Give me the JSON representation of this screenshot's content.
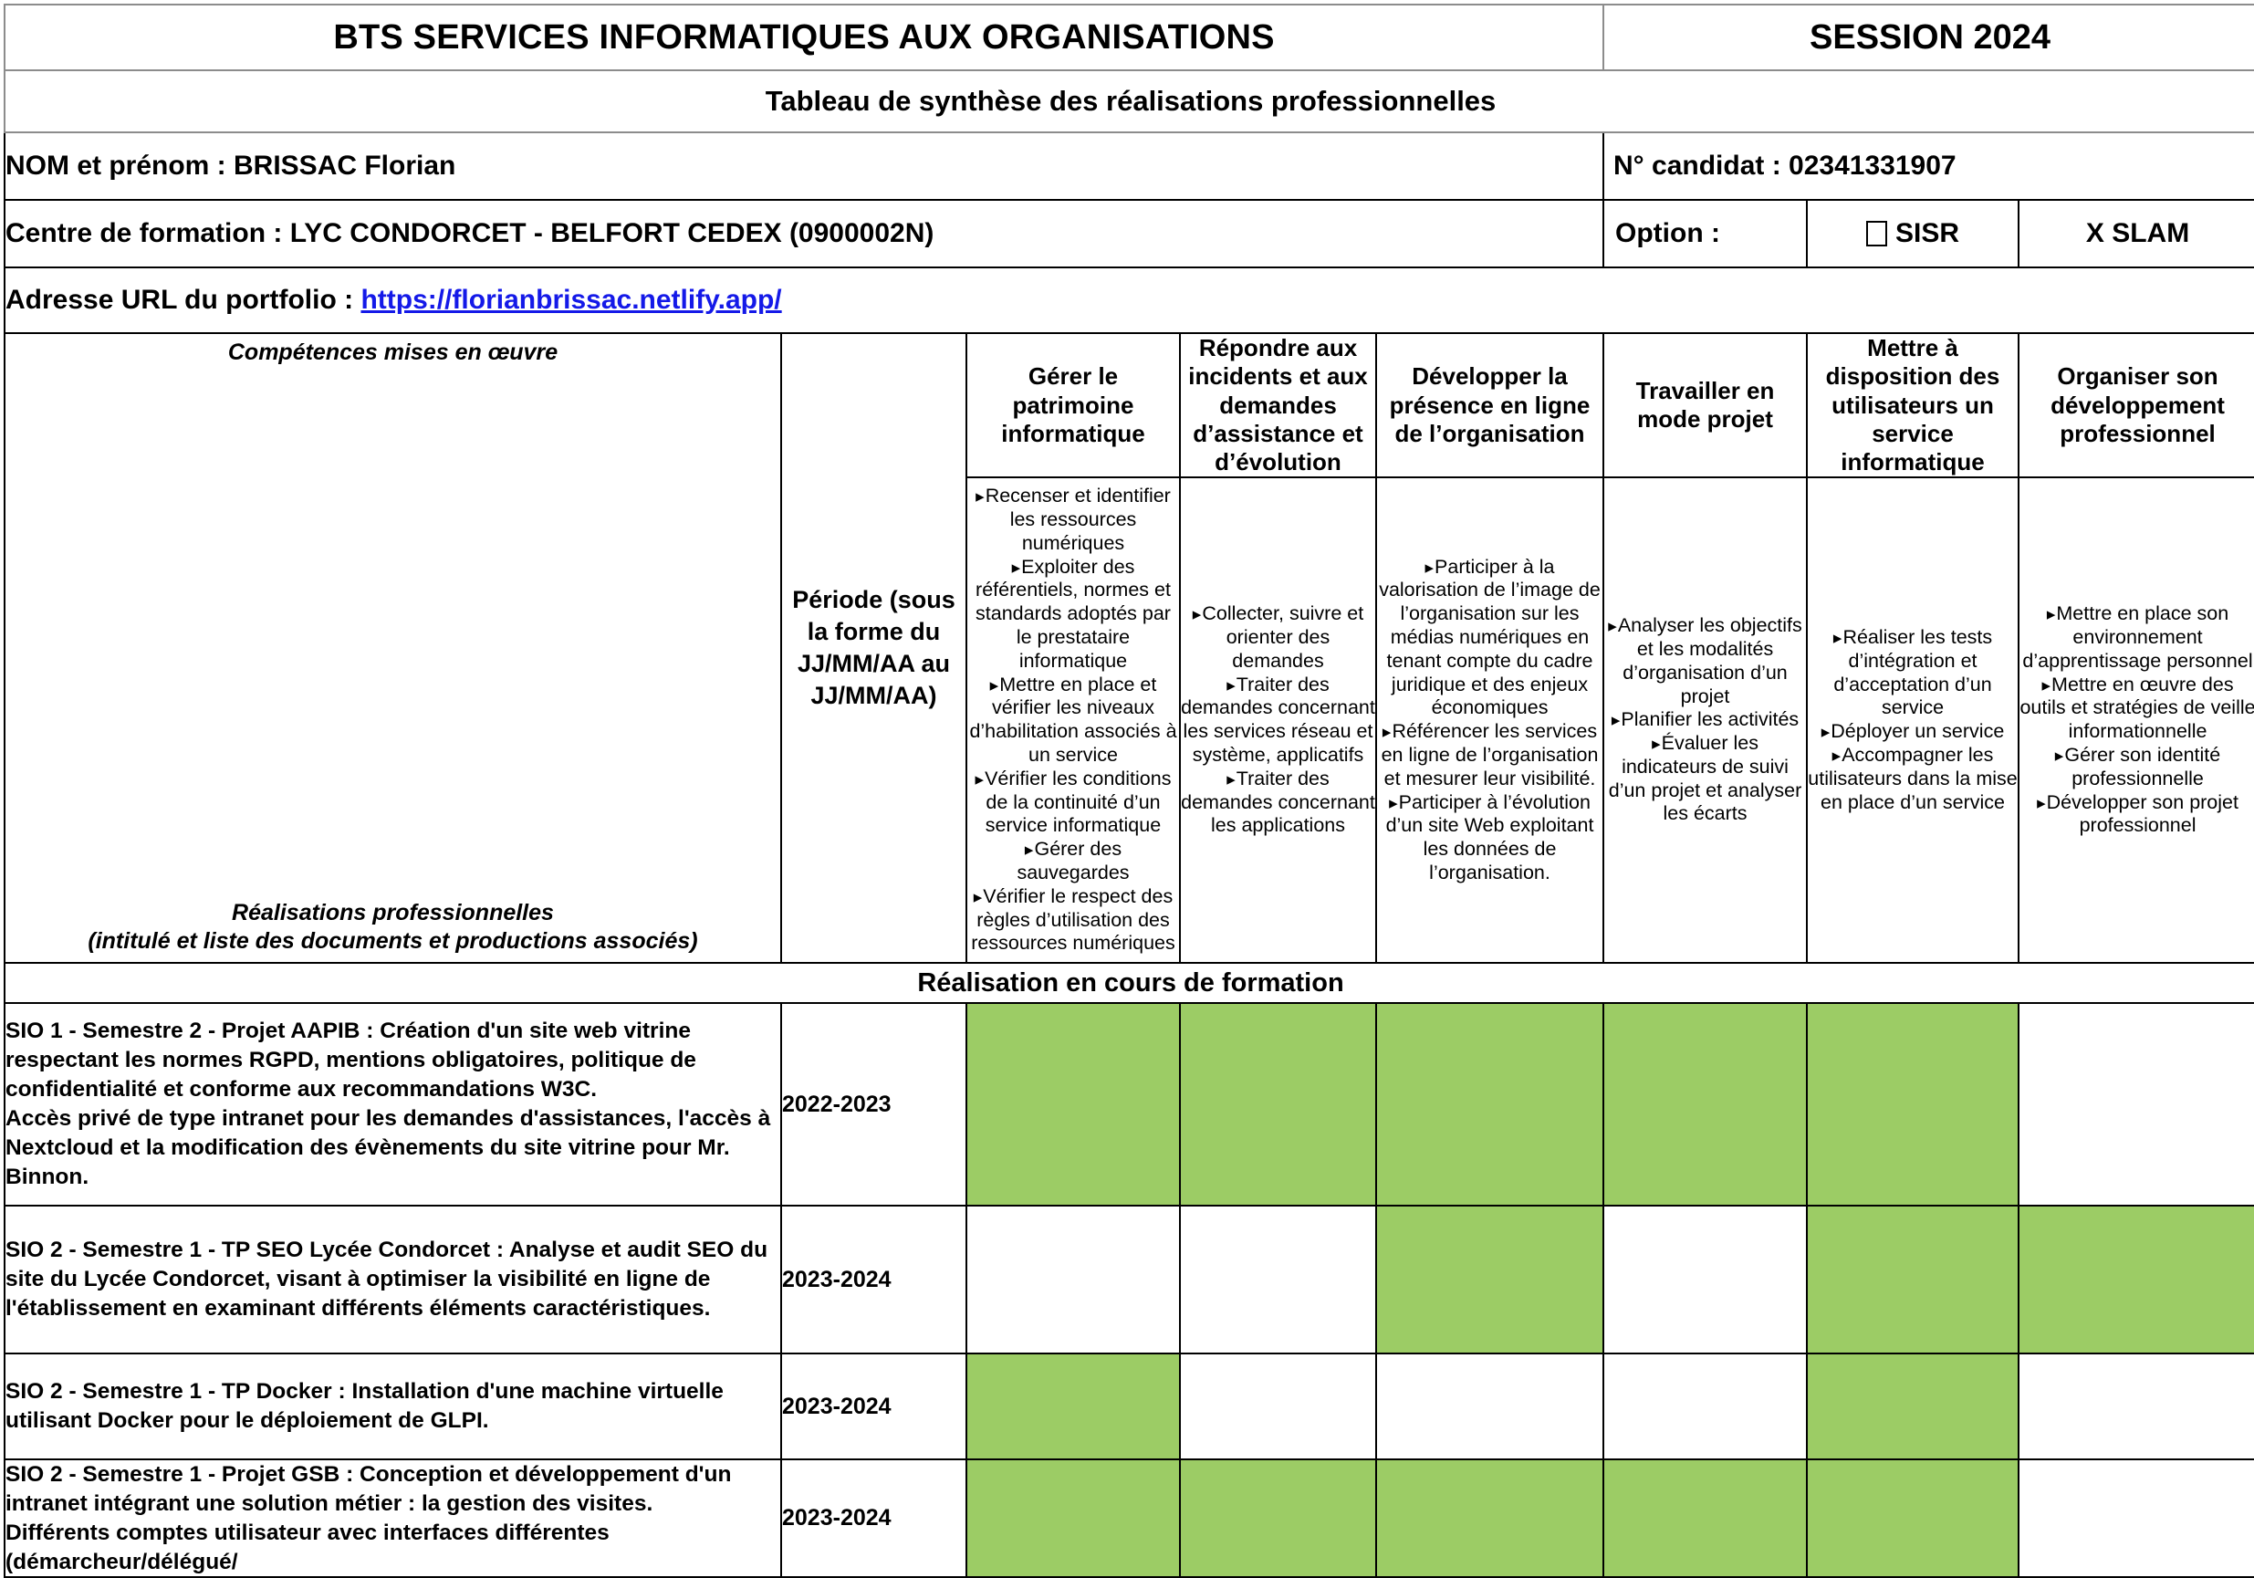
{
  "header": {
    "diploma_title": "BTS SERVICES INFORMATIQUES AUX ORGANISATIONS",
    "session": "SESSION 2024",
    "subtitle": "Tableau de synthèse des réalisations professionnelles",
    "name_label": "NOM et prénom :  BRISSAC Florian",
    "candidate_number": "N° candidat : 02341331907",
    "center_label": "Centre de formation : LYC CONDORCET - BELFORT CEDEX (0900002N)",
    "option_label": "Option :",
    "option_sisr": "SISR",
    "option_slam": "X SLAM",
    "url_label": "Adresse URL du portfolio :",
    "url_value": "https://florianbrissac.netlify.app/"
  },
  "table_head": {
    "competences_label": "Compétences mises en œuvre",
    "realisations_label_line1": "Réalisations professionnelles",
    "realisations_label_line2": "(intitulé et liste des documents et productions associés)",
    "period_header": "Période (sous la forme du JJ/MM/AA au JJ/MM/AA)",
    "section_banner": "Réalisation en cours de formation",
    "competencies": [
      {
        "title": "Gérer le patrimoine informatique",
        "items": [
          "Recenser et identifier les ressources numériques",
          "Exploiter des référentiels, normes et standards adoptés par le prestataire informatique",
          "Mettre en place et vérifier les niveaux d’habilitation associés à un service",
          "Vérifier les conditions de la continuité d’un service informatique",
          "Gérer des sauvegardes",
          "Vérifier le respect des règles d’utilisation des ressources numériques"
        ]
      },
      {
        "title": "Répondre aux incidents et aux demandes d’assistance et d’évolution",
        "items": [
          "Collecter, suivre et orienter des demandes",
          "Traiter des demandes concernant les services réseau et système, applicatifs",
          "Traiter des demandes concernant les applications"
        ]
      },
      {
        "title": "Développer la présence en ligne de l’organisation",
        "items": [
          "Participer à la valorisation de l’image de l’organisation sur les médias numériques en tenant compte du cadre juridique et des enjeux économiques",
          "Référencer les services en ligne de l’organisation et mesurer leur visibilité.",
          "Participer à l’évolution d’un site Web exploitant les données de l’organisation."
        ]
      },
      {
        "title": "Travailler en mode projet",
        "items": [
          "Analyser les objectifs et les modalités d’organisation d’un projet",
          "Planifier les activités",
          "Évaluer les indicateurs de suivi d’un projet et analyser les écarts"
        ]
      },
      {
        "title": "Mettre à disposition des utilisateurs un service informatique",
        "items": [
          "Réaliser les tests d’intégration et d’acceptation d’un service",
          "Déployer un service",
          "Accompagner les utilisateurs dans la mise en place d’un service"
        ]
      },
      {
        "title": "Organiser son développement professionnel",
        "items": [
          "Mettre en place son environnement d’apprentissage personnel",
          "Mettre en œuvre des outils et stratégies de veille informationnelle",
          "Gérer son identité professionnelle",
          "Développer son projet professionnel"
        ]
      }
    ]
  },
  "rows": [
    {
      "description": "SIO 1 - Semestre 2 - Projet AAPIB : Création d'un site web vitrine respectant les normes RGPD, mentions obligatoires, politique de confidentialité et conforme aux recommandations W3C.\nAccès privé de type intranet pour les demandes d'assistances, l'accès à Nextcloud et la modification des évènements du site vitrine pour Mr. Binnon.",
      "period": "2022-2023",
      "marks": [
        true,
        true,
        true,
        true,
        true,
        false
      ]
    },
    {
      "description": "SIO 2 - Semestre 1 - TP SEO Lycée Condorcet : Analyse et audit SEO du site du Lycée Condorcet, visant à optimiser la visibilité en ligne de l'établissement en examinant différents éléments caractéristiques.",
      "period": "2023-2024",
      "marks": [
        false,
        false,
        true,
        false,
        true,
        true
      ]
    },
    {
      "description": "SIO 2 - Semestre 1 - TP Docker : Installation d'une machine virtuelle utilisant Docker pour le déploiement de GLPI.",
      "period": "2023-2024",
      "marks": [
        true,
        false,
        false,
        false,
        true,
        false
      ]
    },
    {
      "description": "SIO 2 - Semestre 1 - Projet GSB : Conception et développement d'un intranet intégrant une solution métier : la gestion des visites.\nDifférents comptes utilisateur avec interfaces différentes (démarcheur/délégué/",
      "period": "2023-2024",
      "marks": [
        true,
        true,
        true,
        true,
        true,
        false
      ]
    }
  ],
  "colors": {
    "mark_green": "#9ccc65",
    "link_blue": "#1419e8"
  }
}
